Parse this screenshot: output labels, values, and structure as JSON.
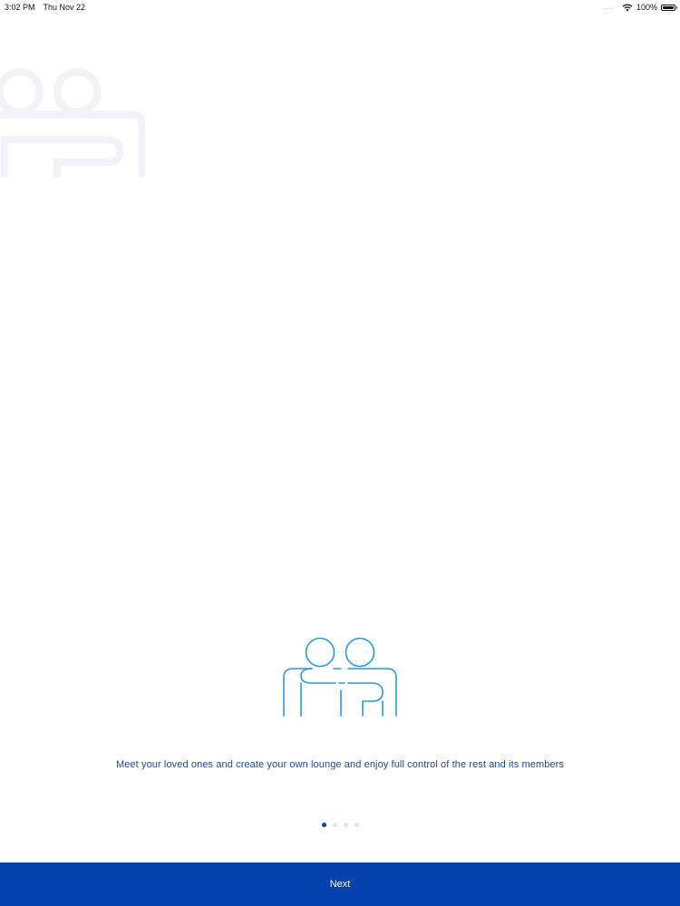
{
  "status_bar": {
    "time": "3:02 PM",
    "date": "Thu Nov 22",
    "signal": "....",
    "battery": "100%",
    "icons": [
      "wifi-icon",
      "battery-icon"
    ]
  },
  "onboarding": {
    "illustration_icon": "people-hug-icon",
    "description": "Meet your loved ones and create your own lounge and enjoy full control of the rest and its members",
    "page_indicator": {
      "total": 4,
      "current": 1
    },
    "next_label": "Next"
  },
  "colors": {
    "accent": "#0341ad",
    "icon_stroke": "#2a9ad6",
    "text": "#1f4a8c",
    "dot_active": "#0a3fa8",
    "dot_inactive": "#dfe3ea"
  }
}
